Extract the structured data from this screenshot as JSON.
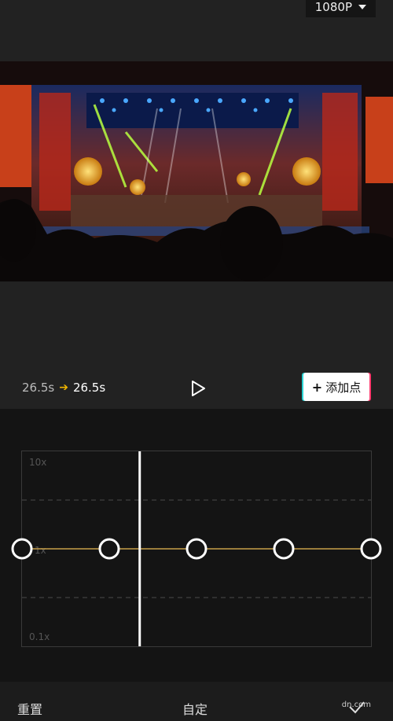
{
  "top_bar": {
    "resolution": "1080P"
  },
  "controls": {
    "time_from": "26.5s",
    "time_to": "26.5s",
    "add_point_label": "添加点"
  },
  "graph": {
    "max_label": "10x",
    "mid_label": "1x",
    "min_label": "0.1x",
    "points": [
      1,
      1,
      1,
      1,
      1
    ],
    "playhead_progress": 0.335
  },
  "bottom_bar": {
    "reset_label": "重置",
    "mode_label": "自定",
    "watermark": "dn.com"
  },
  "colors": {
    "accent": "#f0b400",
    "curve": "#c8a04a"
  }
}
